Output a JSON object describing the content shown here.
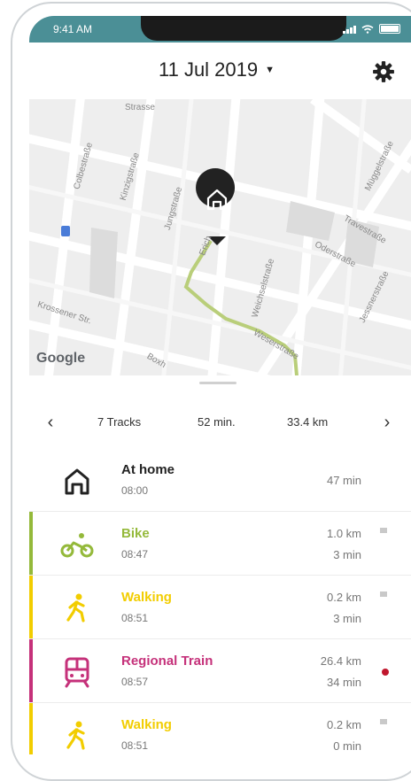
{
  "status": {
    "time": "9:41 AM"
  },
  "header": {
    "date": "11 Jul 2019"
  },
  "map": {
    "streets": [
      "Colbestraße",
      "Kinzigstraße",
      "Jungstraße",
      "Müggelstraße",
      "Travestraße",
      "Oderstraße",
      "Jessnerstraße",
      "Weichselstraße",
      "Krossener Str.",
      "Boxh",
      "Weserstraße",
      "Erich",
      "Strasse"
    ],
    "brand": "Google"
  },
  "stats": {
    "prev": "‹",
    "tracks": "7 Tracks",
    "duration": "52 min.",
    "distance": "33.4 km",
    "next": "›"
  },
  "tracks": [
    {
      "title": "At home",
      "time": "08:00",
      "value1": "",
      "value2": "47 min",
      "color": "#222222",
      "icon": "home-icon",
      "flag": false,
      "dot": false
    },
    {
      "title": "Bike",
      "time": "08:47",
      "value1": "1.0 km",
      "value2": "3 min",
      "color": "#94b93a",
      "icon": "bike-icon",
      "flag": true,
      "dot": false
    },
    {
      "title": "Walking",
      "time": "08:51",
      "value1": "0.2 km",
      "value2": "3 min",
      "color": "#f2cd00",
      "icon": "walking-icon",
      "flag": true,
      "dot": false
    },
    {
      "title": "Regional Train",
      "time": "08:57",
      "value1": "26.4 km",
      "value2": "34 min",
      "color": "#c5317a",
      "icon": "train-icon",
      "flag": false,
      "dot": true
    },
    {
      "title": "Walking",
      "time": "08:51",
      "value1": "0.2 km",
      "value2": "0 min",
      "color": "#f2cd00",
      "icon": "walking-icon",
      "flag": true,
      "dot": false
    }
  ],
  "colors": {
    "statusbar": "#4b8f96",
    "route": "#b9ce7a",
    "marker": "#222222"
  }
}
